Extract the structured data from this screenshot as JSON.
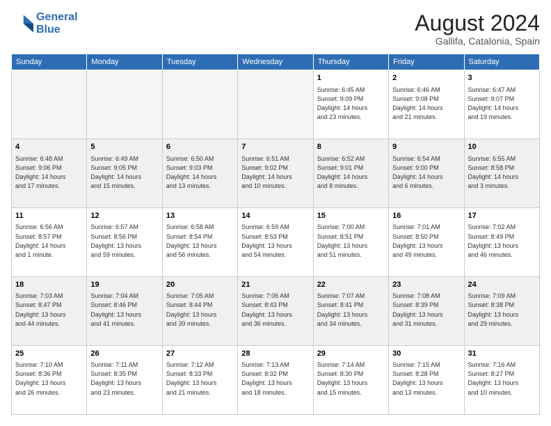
{
  "header": {
    "logo_line1": "General",
    "logo_line2": "Blue",
    "title": "August 2024",
    "subtitle": "Gallifa, Catalonia, Spain"
  },
  "weekdays": [
    "Sunday",
    "Monday",
    "Tuesday",
    "Wednesday",
    "Thursday",
    "Friday",
    "Saturday"
  ],
  "weeks": [
    [
      {
        "day": "",
        "info": "",
        "empty": true
      },
      {
        "day": "",
        "info": "",
        "empty": true
      },
      {
        "day": "",
        "info": "",
        "empty": true
      },
      {
        "day": "",
        "info": "",
        "empty": true
      },
      {
        "day": "1",
        "info": "Sunrise: 6:45 AM\nSunset: 9:09 PM\nDaylight: 14 hours\nand 23 minutes.",
        "empty": false
      },
      {
        "day": "2",
        "info": "Sunrise: 6:46 AM\nSunset: 9:08 PM\nDaylight: 14 hours\nand 21 minutes.",
        "empty": false
      },
      {
        "day": "3",
        "info": "Sunrise: 6:47 AM\nSunset: 9:07 PM\nDaylight: 14 hours\nand 19 minutes.",
        "empty": false
      }
    ],
    [
      {
        "day": "4",
        "info": "Sunrise: 6:48 AM\nSunset: 9:06 PM\nDaylight: 14 hours\nand 17 minutes.",
        "empty": false
      },
      {
        "day": "5",
        "info": "Sunrise: 6:49 AM\nSunset: 9:05 PM\nDaylight: 14 hours\nand 15 minutes.",
        "empty": false
      },
      {
        "day": "6",
        "info": "Sunrise: 6:50 AM\nSunset: 9:03 PM\nDaylight: 14 hours\nand 13 minutes.",
        "empty": false
      },
      {
        "day": "7",
        "info": "Sunrise: 6:51 AM\nSunset: 9:02 PM\nDaylight: 14 hours\nand 10 minutes.",
        "empty": false
      },
      {
        "day": "8",
        "info": "Sunrise: 6:52 AM\nSunset: 9:01 PM\nDaylight: 14 hours\nand 8 minutes.",
        "empty": false
      },
      {
        "day": "9",
        "info": "Sunrise: 6:54 AM\nSunset: 9:00 PM\nDaylight: 14 hours\nand 6 minutes.",
        "empty": false
      },
      {
        "day": "10",
        "info": "Sunrise: 6:55 AM\nSunset: 8:58 PM\nDaylight: 14 hours\nand 3 minutes.",
        "empty": false
      }
    ],
    [
      {
        "day": "11",
        "info": "Sunrise: 6:56 AM\nSunset: 8:57 PM\nDaylight: 14 hours\nand 1 minute.",
        "empty": false
      },
      {
        "day": "12",
        "info": "Sunrise: 6:57 AM\nSunset: 8:56 PM\nDaylight: 13 hours\nand 59 minutes.",
        "empty": false
      },
      {
        "day": "13",
        "info": "Sunrise: 6:58 AM\nSunset: 8:54 PM\nDaylight: 13 hours\nand 56 minutes.",
        "empty": false
      },
      {
        "day": "14",
        "info": "Sunrise: 6:59 AM\nSunset: 8:53 PM\nDaylight: 13 hours\nand 54 minutes.",
        "empty": false
      },
      {
        "day": "15",
        "info": "Sunrise: 7:00 AM\nSunset: 8:51 PM\nDaylight: 13 hours\nand 51 minutes.",
        "empty": false
      },
      {
        "day": "16",
        "info": "Sunrise: 7:01 AM\nSunset: 8:50 PM\nDaylight: 13 hours\nand 49 minutes.",
        "empty": false
      },
      {
        "day": "17",
        "info": "Sunrise: 7:02 AM\nSunset: 8:49 PM\nDaylight: 13 hours\nand 46 minutes.",
        "empty": false
      }
    ],
    [
      {
        "day": "18",
        "info": "Sunrise: 7:03 AM\nSunset: 8:47 PM\nDaylight: 13 hours\nand 44 minutes.",
        "empty": false
      },
      {
        "day": "19",
        "info": "Sunrise: 7:04 AM\nSunset: 8:46 PM\nDaylight: 13 hours\nand 41 minutes.",
        "empty": false
      },
      {
        "day": "20",
        "info": "Sunrise: 7:05 AM\nSunset: 8:44 PM\nDaylight: 13 hours\nand 39 minutes.",
        "empty": false
      },
      {
        "day": "21",
        "info": "Sunrise: 7:06 AM\nSunset: 8:43 PM\nDaylight: 13 hours\nand 36 minutes.",
        "empty": false
      },
      {
        "day": "22",
        "info": "Sunrise: 7:07 AM\nSunset: 8:41 PM\nDaylight: 13 hours\nand 34 minutes.",
        "empty": false
      },
      {
        "day": "23",
        "info": "Sunrise: 7:08 AM\nSunset: 8:39 PM\nDaylight: 13 hours\nand 31 minutes.",
        "empty": false
      },
      {
        "day": "24",
        "info": "Sunrise: 7:09 AM\nSunset: 8:38 PM\nDaylight: 13 hours\nand 29 minutes.",
        "empty": false
      }
    ],
    [
      {
        "day": "25",
        "info": "Sunrise: 7:10 AM\nSunset: 8:36 PM\nDaylight: 13 hours\nand 26 minutes.",
        "empty": false
      },
      {
        "day": "26",
        "info": "Sunrise: 7:11 AM\nSunset: 8:35 PM\nDaylight: 13 hours\nand 23 minutes.",
        "empty": false
      },
      {
        "day": "27",
        "info": "Sunrise: 7:12 AM\nSunset: 8:33 PM\nDaylight: 13 hours\nand 21 minutes.",
        "empty": false
      },
      {
        "day": "28",
        "info": "Sunrise: 7:13 AM\nSunset: 8:32 PM\nDaylight: 13 hours\nand 18 minutes.",
        "empty": false
      },
      {
        "day": "29",
        "info": "Sunrise: 7:14 AM\nSunset: 8:30 PM\nDaylight: 13 hours\nand 15 minutes.",
        "empty": false
      },
      {
        "day": "30",
        "info": "Sunrise: 7:15 AM\nSunset: 8:28 PM\nDaylight: 13 hours\nand 13 minutes.",
        "empty": false
      },
      {
        "day": "31",
        "info": "Sunrise: 7:16 AM\nSunset: 8:27 PM\nDaylight: 13 hours\nand 10 minutes.",
        "empty": false
      }
    ]
  ]
}
